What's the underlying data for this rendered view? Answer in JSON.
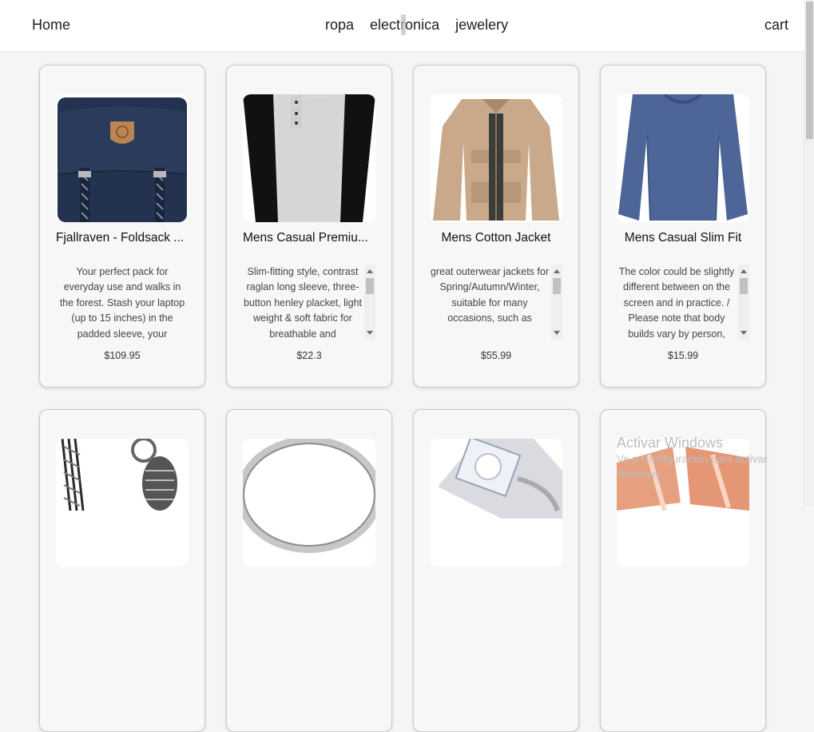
{
  "nav": {
    "home": "Home",
    "categories": [
      "ropa",
      "electronica",
      "jewelery"
    ],
    "cart": "cart"
  },
  "products": [
    {
      "title": "Fjallraven - Foldsack ...",
      "description": "Your perfect pack for everyday use and walks in the forest. Stash your laptop (up to 15 inches) in the padded sleeve, your everyday",
      "price": "$109.95",
      "image_icon": "backpack-icon"
    },
    {
      "title": "Mens Casual Premiu...",
      "description": "Slim-fitting style, contrast raglan long sleeve, three-button henley placket, light weight & soft fabric for breathable and",
      "price": "$22.3",
      "image_icon": "raglan-shirt-icon"
    },
    {
      "title": "Mens Cotton Jacket",
      "description": "great outerwear jackets for Spring/Autumn/Winter, suitable for many occasions, such as",
      "price": "$55.99",
      "image_icon": "jacket-icon"
    },
    {
      "title": "Mens Casual Slim Fit",
      "description": "The color could be slightly different between on the screen and in practice. / Please note that body builds vary by person,",
      "price": "$15.99",
      "image_icon": "long-sleeve-tee-icon"
    }
  ],
  "second_row_images": [
    "bracelet-icon",
    "silver-ring-icon",
    "diamond-ring-icon",
    "gold-rings-icon"
  ],
  "activation": {
    "title": "Activar Windows",
    "subtitle": "Ve a Configuración para activar Windows."
  },
  "colors": {
    "navbar_bg": "#ffffff",
    "page_bg": "#f5f5f5",
    "card_border": "#c9c9c9"
  }
}
